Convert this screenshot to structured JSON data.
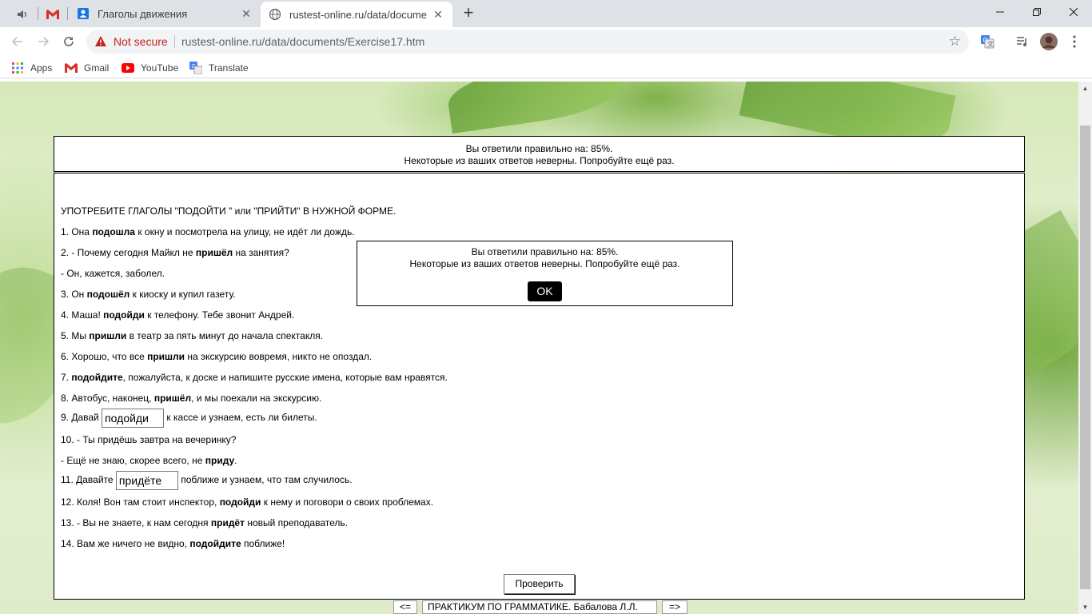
{
  "browser": {
    "tabs": [
      {
        "title": "Глаголы движения",
        "active": false
      },
      {
        "title": "rustest-online.ru/data/document",
        "active": true
      }
    ],
    "address": {
      "security_label": "Not secure",
      "url": "rustest-online.ru/data/documents/Exercise17.htm"
    },
    "bookmarks": [
      {
        "label": "Apps",
        "icon": "apps-grid-icon"
      },
      {
        "label": "Gmail",
        "icon": "gmail-icon"
      },
      {
        "label": "YouTube",
        "icon": "youtube-icon"
      },
      {
        "label": "Translate",
        "icon": "translate-icon"
      }
    ]
  },
  "result": {
    "line1": "Вы ответили правильно на: 85%.",
    "line2": "Некоторые из ваших ответов неверны. Попробуйте ещё раз."
  },
  "exercise": {
    "heading": "УПОТРЕБИТЕ ГЛАГОЛЫ \"ПОДОЙТИ \" или \"ПРИЙТИ\" В НУЖНОЙ ФОРМЕ.",
    "items": {
      "s1": {
        "a": "1. Она ",
        "b": "подошла",
        "c": " к окну и посмотрела на улицу, не идёт ли дождь."
      },
      "s2": {
        "a": "2. - Почему сегодня Майкл не ",
        "b": "пришёл",
        "c": " на занятия?"
      },
      "s2b": {
        "a": "- Он, кажется, заболел."
      },
      "s3": {
        "a": "3. Он ",
        "b": "подошёл",
        "c": " к киоску и купил газету."
      },
      "s4": {
        "a": "4. Маша! ",
        "b": "подойди",
        "c": " к телефону. Тебе звонит Андрей."
      },
      "s5": {
        "a": "5. Мы ",
        "b": "пришли",
        "c": " в театр за пять минут до начала спектакля."
      },
      "s6": {
        "a": "6. Хорошо, что все ",
        "b": "пришли",
        "c": " на экскурсию вовремя, никто не опоздал."
      },
      "s7": {
        "b": "подойдите",
        "a": "7. ",
        "c": ", пожалуйста, к доске и напишите русские имена, которые вам нравятся."
      },
      "s8": {
        "a": "8. Автобус, наконец, ",
        "b": "пришёл",
        "c": ", и мы поехали на экскурсию."
      },
      "s9": {
        "a": "9. Давай ",
        "input": "подойди",
        "c": " к кассе и узнаем, есть ли билеты."
      },
      "s10": {
        "a": "10. - Ты придёшь завтра на вечеринку?"
      },
      "s10b": {
        "a": "- Ещё не знаю, скорее всего, не ",
        "b": "приду",
        "c": "."
      },
      "s11": {
        "a": "11. Давайте ",
        "input": "придёте",
        "c": " поближе и узнаем, что там случилось."
      },
      "s12": {
        "a": "12. Коля! Вон там стоит инспектор, ",
        "b": "подойди",
        "c": " к нему и поговори о своих проблемах."
      },
      "s13": {
        "a": "13. - Вы не знаете, к нам сегодня ",
        "b": "придёт",
        "c": " новый преподаватель."
      },
      "s14": {
        "a": "14. Вам же ничего не видно, ",
        "b": "подойдите",
        "c": " поближе!"
      }
    },
    "check_button": "Проверить"
  },
  "modal": {
    "line1": "Вы ответили правильно на: 85%.",
    "line2": "Некоторые из ваших ответов неверны. Попробуйте ещё раз.",
    "ok_label": "OK"
  },
  "bottom_nav": {
    "prev": "<=",
    "title": "ПРАКТИКУМ ПО ГРАММАТИКЕ. Бабалова Л.Л.",
    "next": "=>"
  },
  "colors": {
    "not_secure": "#c5221f",
    "modal_ok_bg": "#000000",
    "page_bg_green": "#b9d98e"
  }
}
